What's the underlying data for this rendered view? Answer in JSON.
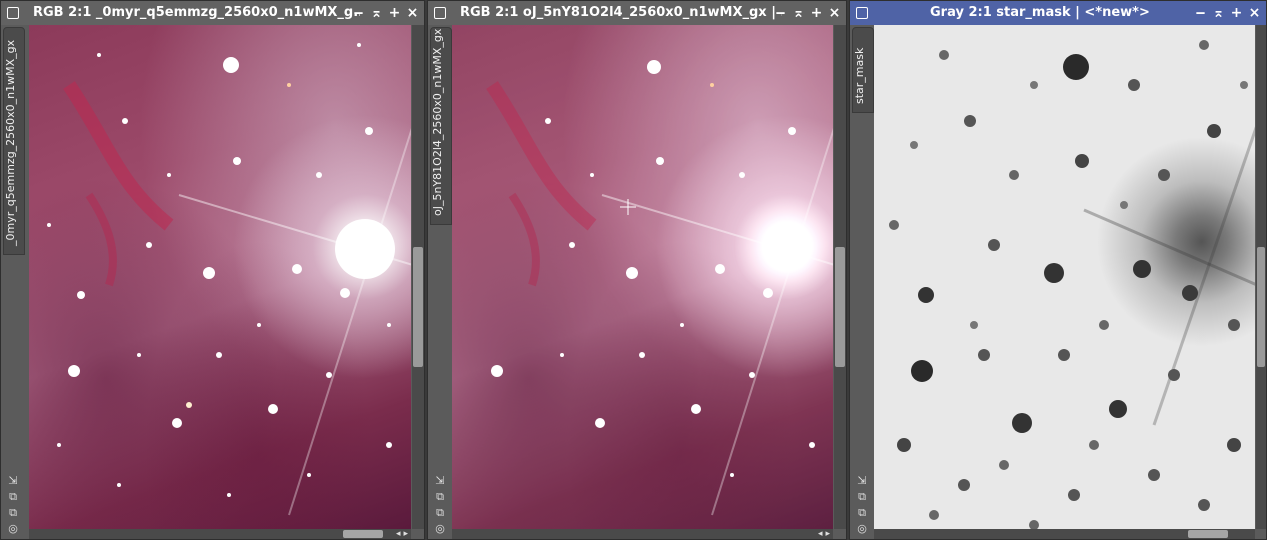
{
  "windows": [
    {
      "title": "RGB 2:1 _0myr_q5emmzg_2560x0_n1wMX_g...",
      "side_tab": "_0myr_q5emmzg_2560x0_n1wMX_gx",
      "buttons": {
        "minimize": "‒",
        "shade": "⌅",
        "maximize": "+",
        "close": "×"
      }
    },
    {
      "title": "RGB 2:1 oJ_5nY81O2l4_2560x0_n1wMX_gx | ...",
      "side_tab": "oJ_5nY81O2l4_2560x0_n1wMX_gx",
      "buttons": {
        "minimize": "‒",
        "shade": "⌅",
        "maximize": "+",
        "close": "×"
      }
    },
    {
      "title": "Gray 2:1 star_mask | <*new*>",
      "side_tab": "star_mask",
      "buttons": {
        "minimize": "‒",
        "shade": "⌅",
        "maximize": "+",
        "close": "×"
      }
    }
  ],
  "side_icons": [
    "⇲",
    "⧉",
    "⧉",
    "◎"
  ],
  "scroll_arrows": {
    "left": "◂",
    "right": "▸"
  },
  "colors": {
    "active_title": "#4f63a6",
    "inactive_title": "#626262"
  }
}
